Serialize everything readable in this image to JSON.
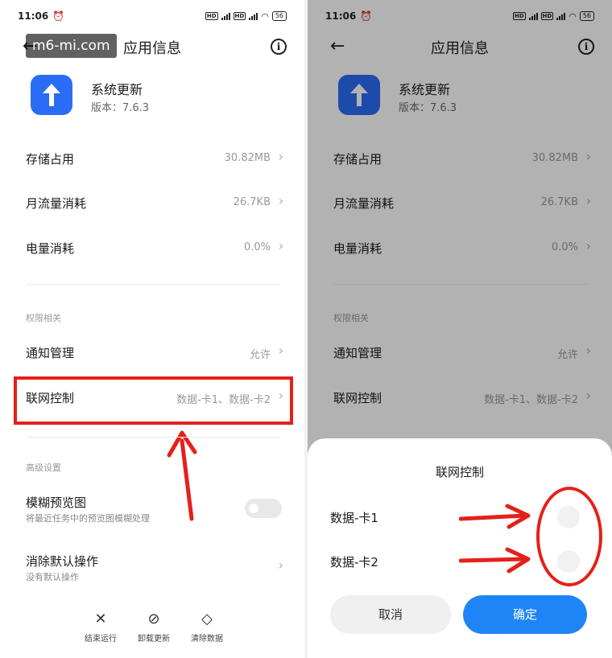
{
  "watermark": "m6-mi.com",
  "status": {
    "time": "11:06",
    "battery": "56",
    "hd": "HD",
    "net": "4G"
  },
  "header": {
    "title": "应用信息"
  },
  "app": {
    "name": "系统更新",
    "version": "版本：7.6.3"
  },
  "rows": [
    {
      "label": "存储占用",
      "value": "30.82MB"
    },
    {
      "label": "月流量消耗",
      "value": "26.7KB"
    },
    {
      "label": "电量消耗",
      "value": "0.0%"
    }
  ],
  "permissions": {
    "section": "权限相关",
    "items": [
      {
        "label": "通知管理",
        "value": "允许"
      },
      {
        "label": "联网控制",
        "value": "数据-卡1、数据-卡2"
      }
    ]
  },
  "advanced": {
    "section": "高级设置",
    "blur": {
      "label": "模糊预览图",
      "sub": "将最近任务中的预览图模糊处理",
      "enabled": false
    },
    "clear_default": {
      "label": "消除默认操作",
      "sub": "没有默认操作"
    }
  },
  "bottom_actions": [
    {
      "icon": "close-icon",
      "label": "结束运行"
    },
    {
      "icon": "block-icon",
      "label": "卸载更新"
    },
    {
      "icon": "eraser-icon",
      "label": "清除数据"
    }
  ],
  "sheet": {
    "title": "联网控制",
    "options": [
      {
        "label": "数据-卡1",
        "enabled": false
      },
      {
        "label": "数据-卡2",
        "enabled": false
      }
    ],
    "cancel": "取消",
    "confirm": "确定"
  },
  "colors": {
    "accent": "#1f85f7",
    "app_icon": "#2a6cf5",
    "annotation": "#e5201a"
  }
}
